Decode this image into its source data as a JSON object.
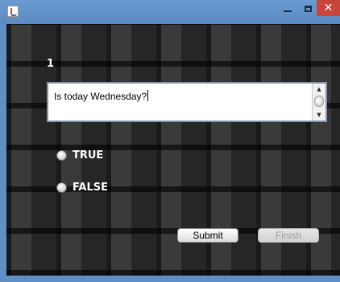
{
  "window": {
    "close_glyph": "✕"
  },
  "question": {
    "number": "1",
    "text": "Is today Wednesday?"
  },
  "options": [
    {
      "label": "TRUE",
      "selected": false
    },
    {
      "label": "FALSE",
      "selected": false
    }
  ],
  "buttons": {
    "submit_label": "Submit",
    "finish_label": "Finish",
    "finish_enabled": false
  },
  "scrollbar": {
    "up_glyph": "▲",
    "down_glyph": "▼"
  },
  "colors": {
    "title_bar": "#5f8fc4",
    "close_button": "#c7453a",
    "text_on_background": "#ffffff"
  }
}
